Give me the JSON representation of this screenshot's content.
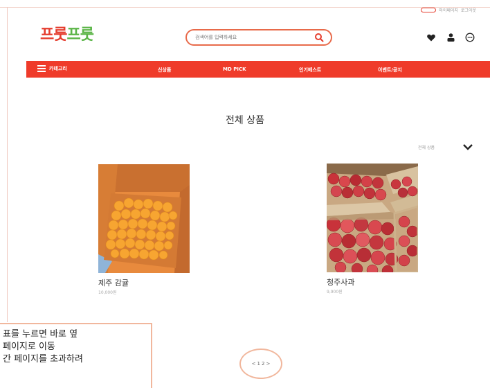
{
  "top_bar": {
    "link_1": "마이페이지",
    "link_2": "로그아웃"
  },
  "header": {
    "logo_part_1": "프룻",
    "logo_part_2": "프룻",
    "search_placeholder": "검색어를 입력하세요"
  },
  "nav": {
    "items": [
      "카테고리",
      "신상품",
      "MD PICK",
      "인기베스트",
      "이벤트/공지"
    ]
  },
  "main": {
    "section_title": "전체 상품",
    "sort_label": "전체 상품"
  },
  "products": [
    {
      "name": "제주 감귤",
      "price": "10,000원"
    },
    {
      "name": "청주사과",
      "price": "9,900원"
    }
  ],
  "pagination": {
    "prev": "<",
    "pages": [
      "1",
      "2"
    ],
    "next": ">"
  },
  "annotation": {
    "lines": [
      "표를 누르면 바로 옆",
      " 페이지로 이동",
      "간 페이지를 초과하려"
    ]
  },
  "colors": {
    "brand_red": "#ef3b2a",
    "logo_green": "#5bb548",
    "annotation_border": "#f1b79d"
  },
  "icons": [
    "search-icon",
    "heart-icon",
    "user-icon",
    "chat-icon",
    "hamburger-icon",
    "chevron-down-icon"
  ]
}
